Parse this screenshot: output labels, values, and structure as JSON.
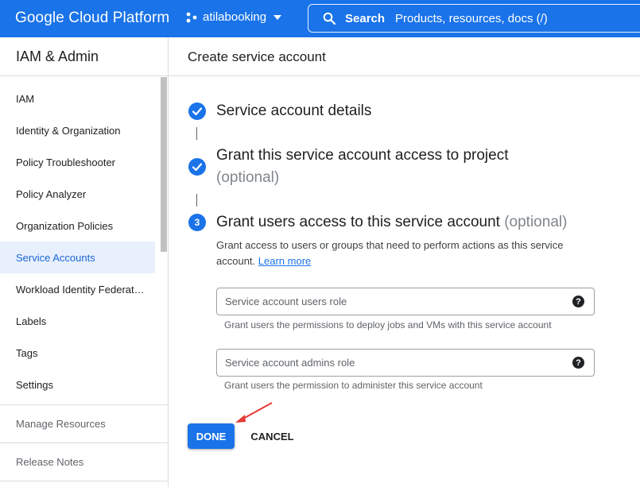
{
  "header": {
    "brand": "Google Cloud Platform",
    "project": "atilabooking",
    "search_label": "Search",
    "search_placeholder": "Products, resources, docs (/)",
    "color": "#1a73e8"
  },
  "sidebar": {
    "title": "IAM & Admin",
    "items": [
      {
        "label": "IAM",
        "active": false
      },
      {
        "label": "Identity & Organization",
        "active": false
      },
      {
        "label": "Policy Troubleshooter",
        "active": false
      },
      {
        "label": "Policy Analyzer",
        "active": false
      },
      {
        "label": "Organization Policies",
        "active": false
      },
      {
        "label": "Service Accounts",
        "active": true
      },
      {
        "label": "Workload Identity Federat…",
        "active": false
      },
      {
        "label": "Labels",
        "active": false
      },
      {
        "label": "Tags",
        "active": false
      },
      {
        "label": "Settings",
        "active": false
      }
    ],
    "manage_resources": "Manage Resources",
    "release_notes": "Release Notes"
  },
  "main": {
    "title": "Create service account",
    "steps": [
      {
        "label": "Service account details",
        "optional": "",
        "icon": "check-icon"
      },
      {
        "label": "Grant this service account access to project",
        "optional": "(optional)",
        "icon": "check-icon"
      },
      {
        "label": "Grant users access to this service account",
        "optional": "(optional)",
        "number": "3"
      }
    ],
    "description": "Grant access to users or groups that need to perform actions as this service account.",
    "learn_more": "Learn more",
    "fields": [
      {
        "placeholder": "Service account users role",
        "hint": "Grant users the permissions to deploy jobs and VMs with this service account"
      },
      {
        "placeholder": "Service account admins role",
        "hint": "Grant users the permission to administer this service account"
      }
    ],
    "help_glyph": "?",
    "done_label": "DONE",
    "cancel_label": "CANCEL"
  }
}
